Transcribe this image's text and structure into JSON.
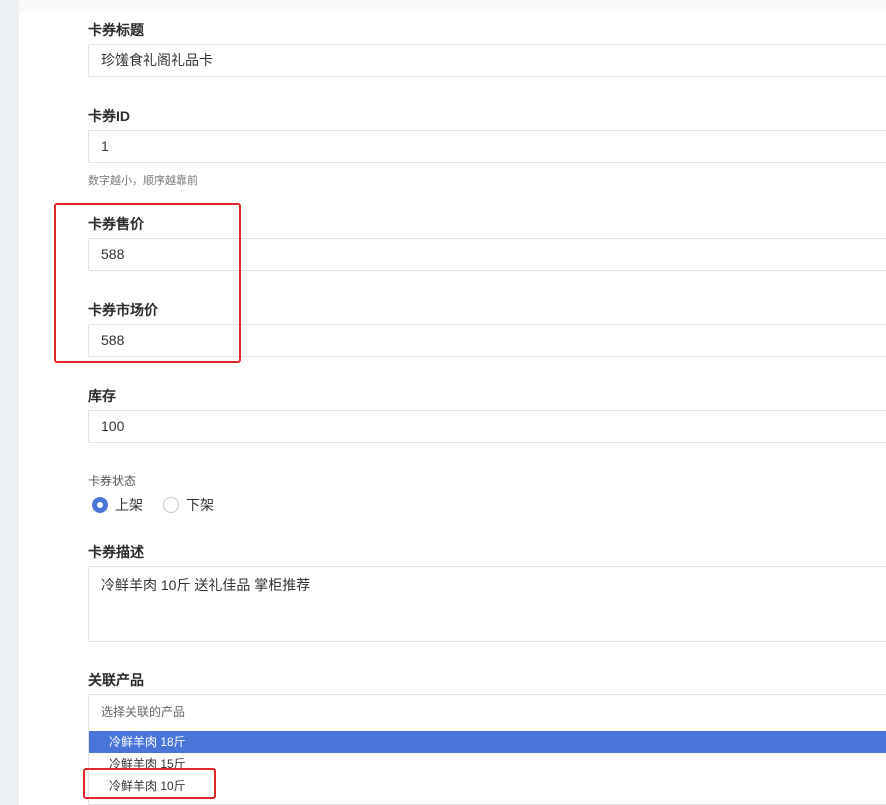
{
  "form": {
    "title_label": "卡券标题",
    "title_value": "珍馐食礼阁礼品卡",
    "id_label": "卡券ID",
    "id_value": "1",
    "id_hint": "数字越小，顺序越靠前",
    "price_label": "卡券售价",
    "price_value": "588",
    "market_price_label": "卡券市场价",
    "market_price_value": "588",
    "stock_label": "库存",
    "stock_value": "100",
    "status_label": "卡券状态",
    "status_options": [
      {
        "label": "上架",
        "checked": true
      },
      {
        "label": "下架",
        "checked": false
      }
    ],
    "description_label": "卡券描述",
    "description_value": "冷鲜羊肉 10斤 送礼佳品 掌柜推荐",
    "related_product_label": "关联产品",
    "related_product_placeholder": "选择关联的产品",
    "related_product_options": [
      {
        "label": "冷鲜羊肉 18斤",
        "selected": true
      },
      {
        "label": "冷鲜羊肉 15斤",
        "selected": false
      },
      {
        "label": "冷鲜羊肉 10斤",
        "selected": false
      }
    ]
  },
  "colors": {
    "accent": "#4a75d8",
    "annotation_red": "#e3262a"
  }
}
